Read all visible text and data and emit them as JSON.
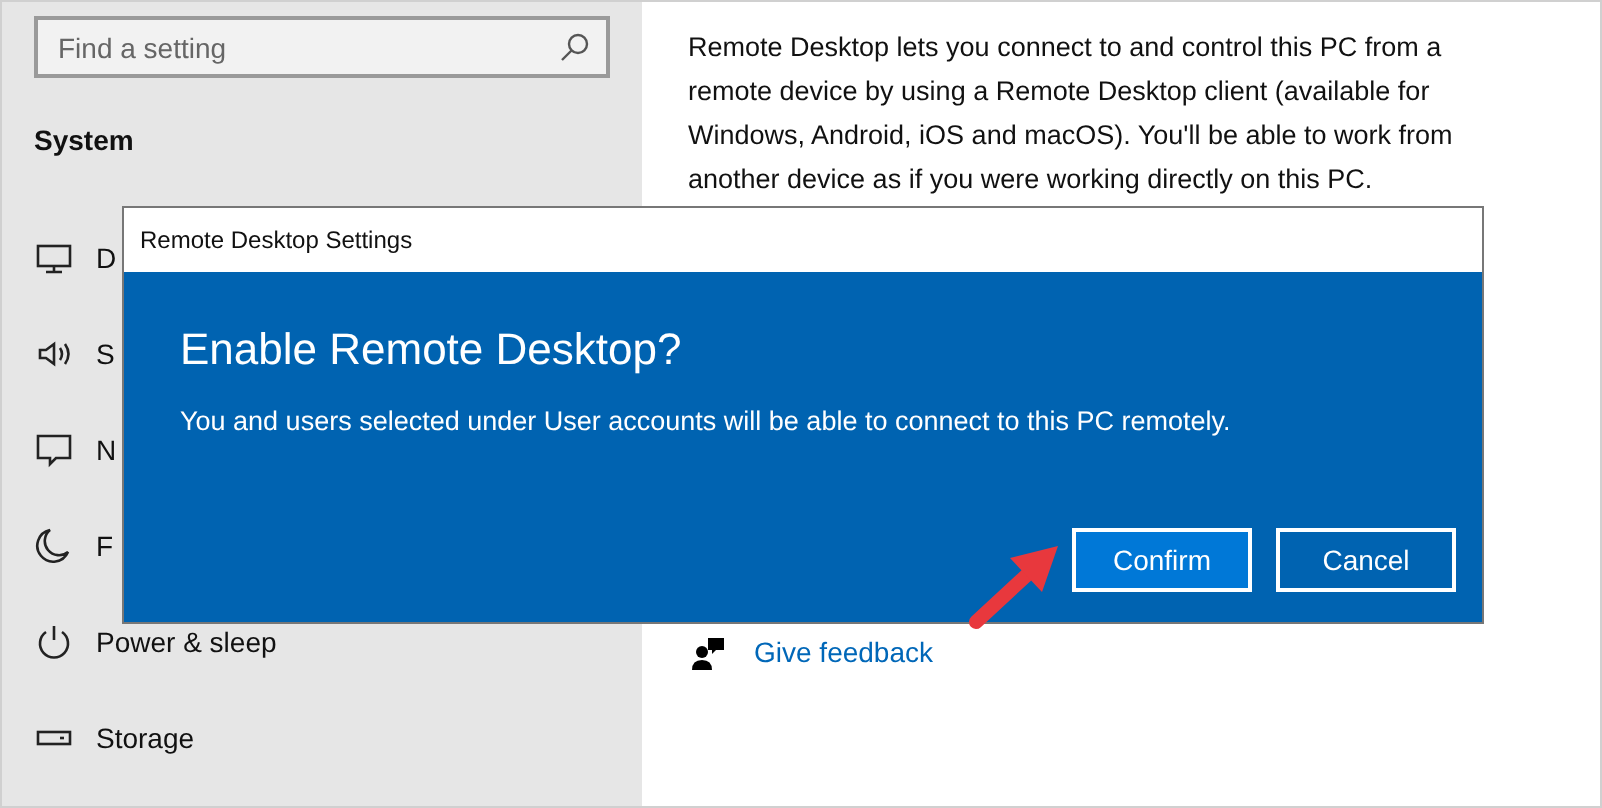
{
  "search": {
    "placeholder": "Find a setting"
  },
  "sidebar": {
    "heading": "System",
    "items": [
      {
        "kind": "display",
        "label": "D"
      },
      {
        "kind": "sound",
        "label": "S"
      },
      {
        "kind": "notifications",
        "label": "N"
      },
      {
        "kind": "focus",
        "label": "F"
      },
      {
        "kind": "power",
        "label": "Power & sleep"
      },
      {
        "kind": "storage",
        "label": "Storage"
      }
    ]
  },
  "content": {
    "description": "Remote Desktop lets you connect to and control this PC from a remote device by using a Remote Desktop client (available for Windows, Android, iOS and macOS). You'll be able to work from another device as if you were working directly on this PC.",
    "links": [
      {
        "kind": "feedback",
        "label": "Give feedback"
      }
    ]
  },
  "dialog": {
    "title": "Remote Desktop Settings",
    "heading": "Enable Remote Desktop?",
    "message": "You and users selected under User accounts will be able to connect to this PC remotely.",
    "buttons": [
      {
        "label": "Confirm",
        "selected": true
      },
      {
        "label": "Cancel",
        "selected": false
      }
    ]
  }
}
